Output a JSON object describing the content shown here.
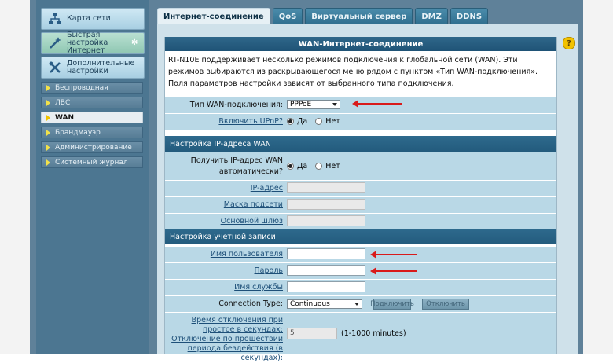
{
  "sidebar": {
    "big_buttons": [
      {
        "label": "Карта сети",
        "icon": "network-map-icon"
      },
      {
        "label": "Быстрая настройка Интернет",
        "icon": "wizard-wand-icon"
      },
      {
        "label": "Дополнительные настройки",
        "icon": "tools-icon"
      }
    ],
    "items": [
      {
        "label": "Беспроводная"
      },
      {
        "label": "ЛВС"
      },
      {
        "label": "WAN"
      },
      {
        "label": "Брандмауэр"
      },
      {
        "label": "Администрирование"
      },
      {
        "label": "Системный журнал"
      }
    ],
    "active_item": "WAN"
  },
  "tabs": [
    {
      "label": "Интернет-соединение"
    },
    {
      "label": "QoS"
    },
    {
      "label": "Виртуальный сервер"
    },
    {
      "label": "DMZ"
    },
    {
      "label": "DDNS"
    }
  ],
  "active_tab": "Интернет-соединение",
  "panel": {
    "title": "WAN-Интернет-соединение",
    "help": "?",
    "intro": "RT-N10E поддерживает несколько режимов подключения к глобальной сети (WAN). Эти режимов выбираются из раскрывающегося меню рядом с пунктом «Тип WAN-подключения». Поля параметров настройки зависят от выбранного типа подключения."
  },
  "form": {
    "wan_type_label": "Тип WAN-подключения:",
    "wan_type_value": "PPPoE",
    "upnp_label": "Включить UPnP?",
    "yes": "Да",
    "no": "Нет",
    "ip_section": "Настройка IP-адреса WAN",
    "auto_ip_label": "Получить IP-адрес WAN автоматически?",
    "ip_label": "IP-адрес",
    "mask_label": "Маска подсети",
    "gateway_label": "Основной шлюз",
    "account_section": "Настройка учетной записи",
    "username_label": "Имя пользователя",
    "password_label": "Пароль",
    "service_label": "Имя службы",
    "conn_type_label": "Connection Type:",
    "conn_type_value": "Continuous",
    "connect_btn": "Подключить",
    "disconnect_btn": "Отключить",
    "idle_label": "Время отключения при простое в секундах: Отключение по прошествии периода бездействия (в секундах):",
    "idle_value": "5",
    "idle_hint": "(1-1000 minutes)"
  },
  "colors": {
    "accent": "#235b7d",
    "annotation_arrow": "#d91a1a",
    "row_bg": "#b9d8e6"
  }
}
